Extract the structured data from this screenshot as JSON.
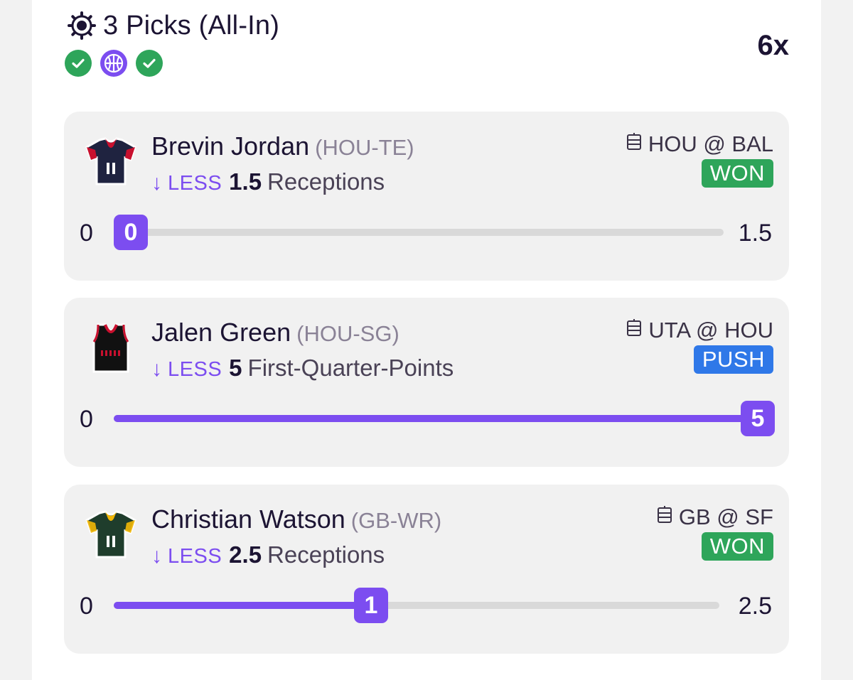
{
  "header": {
    "title": "3 Picks (All-In)",
    "multiplier": "6x",
    "status_icons": [
      "check-icon",
      "basketball-icon",
      "check-icon"
    ]
  },
  "colors": {
    "accent": "#7c4df0",
    "won": "#2ea55a",
    "push": "#2f78e8"
  },
  "picks": [
    {
      "player": "Brevin Jordan",
      "position": "(HOU-TE)",
      "direction": "LESS",
      "line": "1.5",
      "stat": "Receptions",
      "matchup": "HOU @ BAL",
      "result": "WON",
      "range_min": "0",
      "range_max": "1.5",
      "current": "0",
      "progress": 0.0
    },
    {
      "player": "Jalen Green",
      "position": "(HOU-SG)",
      "direction": "LESS",
      "line": "5",
      "stat": "First-Quarter-Points",
      "matchup": "UTA @ HOU",
      "result": "PUSH",
      "range_min": "0",
      "range_max": "",
      "current": "5",
      "progress": 1.0
    },
    {
      "player": "Christian Watson",
      "position": "(GB-WR)",
      "direction": "LESS",
      "line": "2.5",
      "stat": "Receptions",
      "matchup": "GB @ SF",
      "result": "WON",
      "range_min": "0",
      "range_max": "2.5",
      "current": "1",
      "progress": 0.4
    }
  ]
}
